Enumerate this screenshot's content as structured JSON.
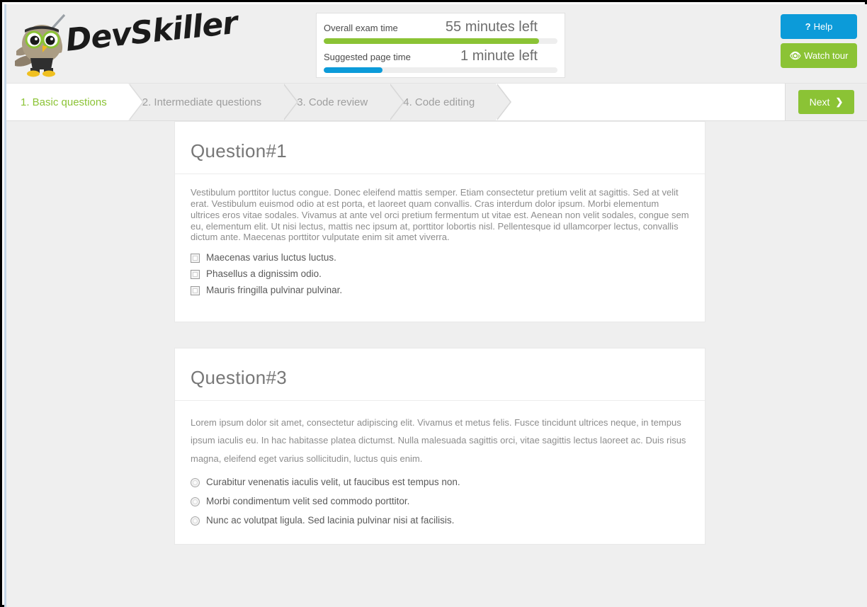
{
  "brand": {
    "name": "DevSkiller",
    "logo_icon": "owl-ninja-logo"
  },
  "timer": {
    "overall": {
      "label": "Overall exam time",
      "value": "55 minutes left",
      "progress_percent": 92,
      "color": "#8bc335"
    },
    "page": {
      "label": "Suggested page time",
      "value": "1 minute left",
      "progress_percent": 25,
      "color": "#0c9bd9"
    }
  },
  "header_buttons": {
    "help": {
      "label": "Help",
      "glyph": "?",
      "icon": "question-mark-icon",
      "color": "#0c9bd9"
    },
    "watch_tour": {
      "label": "Watch tour",
      "glyph": "◉",
      "icon": "eye-icon",
      "color": "#8bc335"
    }
  },
  "tabs": [
    {
      "label": "1. Basic questions",
      "active": true
    },
    {
      "label": "2. Intermediate questions",
      "active": false
    },
    {
      "label": "3. Code review",
      "active": false
    },
    {
      "label": "4. Code editing",
      "active": false
    }
  ],
  "next_button": {
    "label": "Next",
    "chevron": "❯",
    "icon": "chevron-right-icon"
  },
  "questions": [
    {
      "title": "Question#1",
      "text": "Vestibulum porttitor luctus congue. Donec eleifend mattis semper. Etiam consectetur pretium velit at sagittis. Sed at velit erat. Vestibulum euismod odio at est porta, et laoreet quam convallis. Cras interdum dolor ipsum. Morbi elementum ultrices eros vitae sodales. Vivamus at ante vel orci pretium fermentum ut vitae est. Aenean non velit sodales, congue sem eu, elementum elit. Ut nisi lectus, mattis nec ipsum at, porttitor lobortis nisl. Pellentesque id ullamcorper lectus, convallis dictum ante. Maecenas porttitor vulputate enim sit amet viverra.",
      "input_type": "checkbox",
      "options": [
        "Maecenas varius luctus luctus.",
        "Phasellus a dignissim odio.",
        "Mauris fringilla pulvinar pulvinar."
      ]
    },
    {
      "title": "Question#3",
      "text": "Lorem ipsum dolor sit amet, consectetur adipiscing elit. Vivamus et metus felis. Fusce tincidunt ultrices neque, in tempus ipsum iaculis eu. In hac habitasse platea dictumst. Nulla malesuada sagittis orci, vitae sagittis lectus laoreet ac. Duis risus magna, eleifend eget varius sollicitudin, luctus quis enim.",
      "input_type": "radio",
      "options": [
        "Curabitur venenatis iaculis velit, ut faucibus est tempus non.",
        "Morbi condimentum velit sed commodo porttitor.",
        "Nunc ac volutpat ligula. Sed lacinia pulvinar nisi at facilisis."
      ]
    }
  ]
}
